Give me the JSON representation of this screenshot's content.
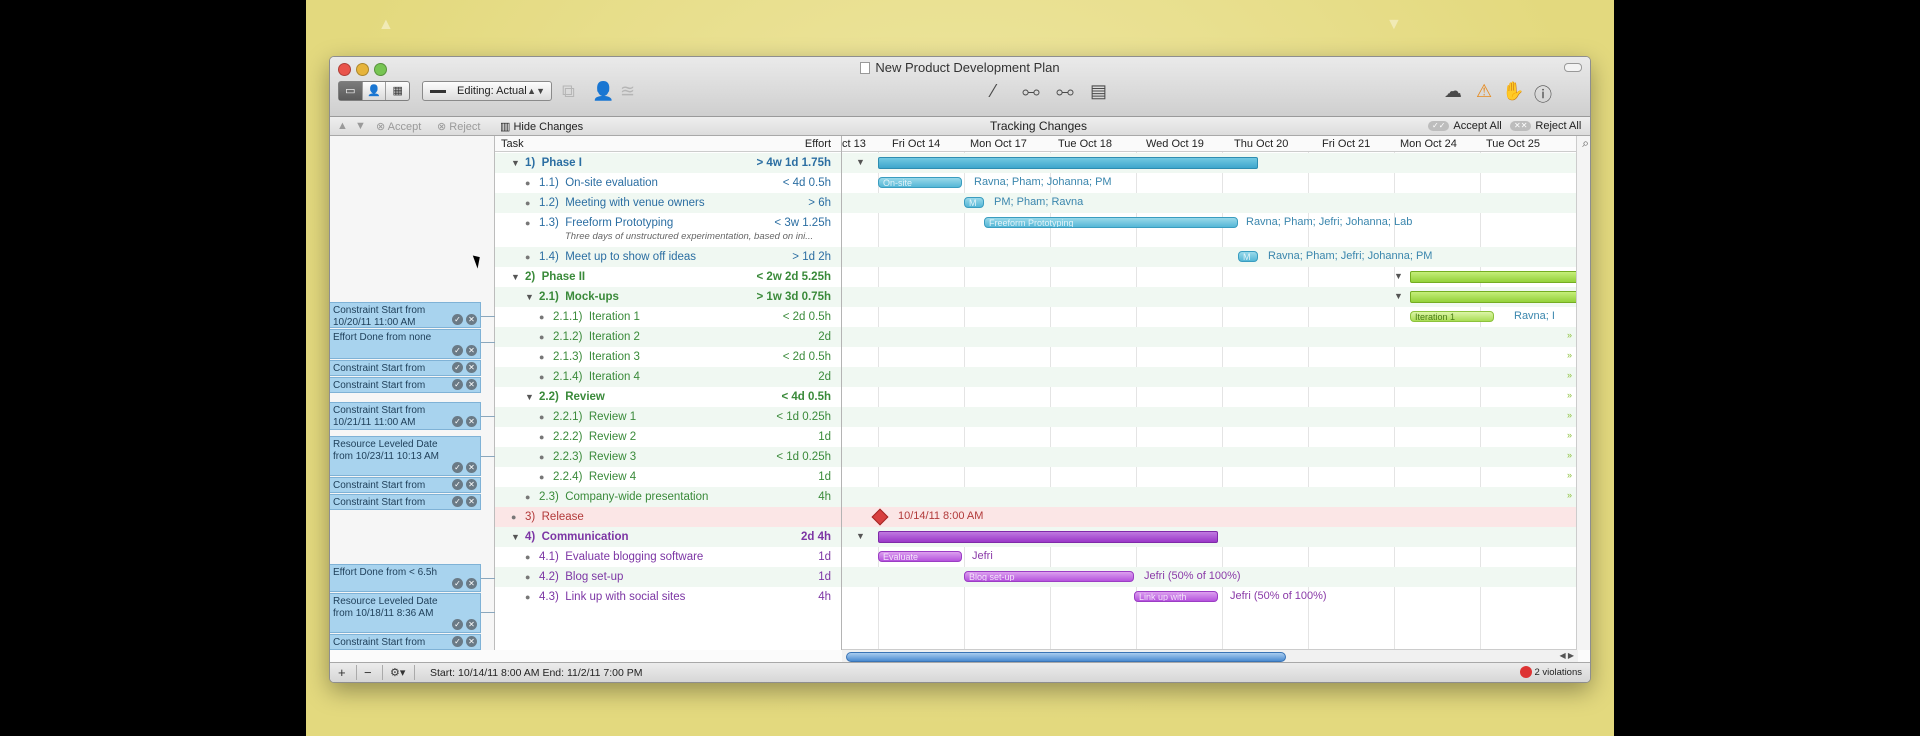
{
  "window": {
    "title": "New Product Development Plan"
  },
  "toolbar": {
    "view_segments": [
      "▭",
      "👤",
      "▦"
    ],
    "editing_label": "Editing: Actual"
  },
  "changes_bar": {
    "accept": "Accept",
    "reject": "Reject",
    "hide_changes": "Hide Changes",
    "tracking_title": "Tracking Changes",
    "accept_all": "Accept All",
    "reject_all": "Reject All"
  },
  "outline": {
    "headers": {
      "task": "Task",
      "effort": "Effort"
    },
    "rows": [
      {
        "num": "1)",
        "name": "Phase I",
        "effort": "> 4w 1d 1.75h"
      },
      {
        "num": "1.1)",
        "name": "On-site evaluation",
        "effort": "< 4d 0.5h"
      },
      {
        "num": "1.2)",
        "name": "Meeting with venue owners",
        "effort": "> 6h"
      },
      {
        "num": "1.3)",
        "name": "Freeform Prototyping",
        "effort": "< 3w 1.25h",
        "note": "Three days of unstructured experimentation, based on ini..."
      },
      {
        "num": "1.4)",
        "name": "Meet up to show off ideas",
        "effort": "> 1d 2h"
      },
      {
        "num": "2)",
        "name": "Phase II",
        "effort": "< 2w 2d 5.25h"
      },
      {
        "num": "2.1)",
        "name": "Mock-ups",
        "effort": "> 1w 3d 0.75h"
      },
      {
        "num": "2.1.1)",
        "name": "Iteration 1",
        "effort": "< 2d 0.5h"
      },
      {
        "num": "2.1.2)",
        "name": "Iteration 2",
        "effort": "2d"
      },
      {
        "num": "2.1.3)",
        "name": "Iteration 3",
        "effort": "< 2d 0.5h"
      },
      {
        "num": "2.1.4)",
        "name": "Iteration 4",
        "effort": "2d"
      },
      {
        "num": "2.2)",
        "name": "Review",
        "effort": "< 4d 0.5h"
      },
      {
        "num": "2.2.1)",
        "name": "Review 1",
        "effort": "< 1d 0.25h"
      },
      {
        "num": "2.2.2)",
        "name": "Review 2",
        "effort": "1d"
      },
      {
        "num": "2.2.3)",
        "name": "Review 3",
        "effort": "< 1d 0.25h"
      },
      {
        "num": "2.2.4)",
        "name": "Review 4",
        "effort": "1d"
      },
      {
        "num": "2.3)",
        "name": "Company-wide presentation",
        "effort": "4h"
      },
      {
        "num": "3)",
        "name": "Release",
        "effort": ""
      },
      {
        "num": "4)",
        "name": "Communication",
        "effort": "2d 4h"
      },
      {
        "num": "4.1)",
        "name": "Evaluate blogging software",
        "effort": "1d"
      },
      {
        "num": "4.2)",
        "name": "Blog set-up",
        "effort": "1d"
      },
      {
        "num": "4.3)",
        "name": "Link up with social sites",
        "effort": "4h"
      }
    ]
  },
  "changes": [
    {
      "text": "Constraint Start from 10/20/11 11:00 AM"
    },
    {
      "text": "Effort Done from none"
    },
    {
      "text": "Constraint Start from"
    },
    {
      "text": "Constraint Start from"
    },
    {
      "text": "Constraint Start from 10/21/11 11:00 AM"
    },
    {
      "text": "Resource Leveled Date from 10/23/11 10:13 AM"
    },
    {
      "text": "Constraint Start from"
    },
    {
      "text": "Constraint Start from"
    },
    {
      "text": "Effort Done from < 6.5h"
    },
    {
      "text": "Resource Leveled Date from 10/18/11 8:36 AM"
    },
    {
      "text": "Constraint Start from"
    }
  ],
  "gantt": {
    "dates": [
      "ct 13",
      "Fri Oct 14",
      "Mon Oct 17",
      "Tue Oct 18",
      "Wed Oct 19",
      "Thu Oct 20",
      "Fri Oct 21",
      "Mon Oct 24",
      "Tue Oct 25"
    ],
    "bar_labels": {
      "onsite": "On-site",
      "m": "M",
      "freeform": "Freeform Prototyping",
      "m2": "M",
      "iter1": "Iteration 1",
      "evaluate": "Evaluate",
      "blogsetup": "Blog set-up",
      "linkup": "Link up with"
    },
    "resources": {
      "r11": "Ravna; Pham; Johanna; PM",
      "r12": "PM; Pham; Ravna",
      "r13": "Ravna; Pham; Jefri; Johanna; Lab",
      "r14": "Ravna; Pham; Jefri; Johanna; PM",
      "r211": "Ravna; I",
      "release": "10/14/11 8:00 AM",
      "r41": "Jefri",
      "r42": "Jefri (50% of 100%)",
      "r43": "Jefri (50% of 100%)"
    }
  },
  "statusbar": {
    "range": "Start: 10/14/11 8:00 AM End: 11/2/11 7:00 PM",
    "violations": "2 violations"
  },
  "colors": {
    "accent_blue": "#55b7d6",
    "accent_green": "#a9dd55",
    "accent_purple": "#b553dd",
    "release_red": "#d8403f"
  }
}
